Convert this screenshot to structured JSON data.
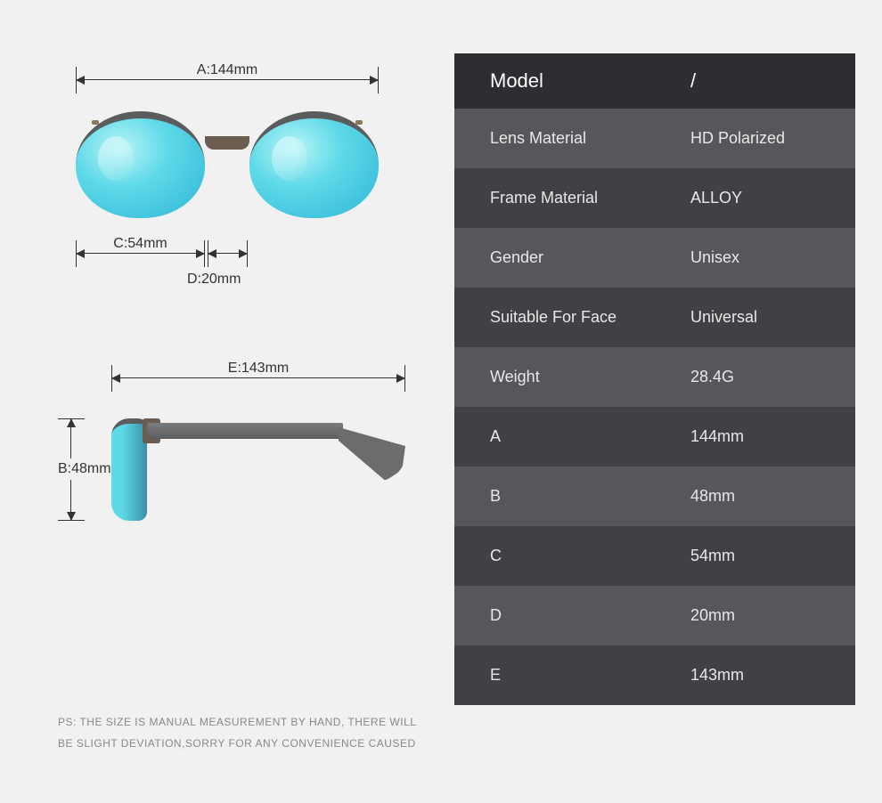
{
  "dimensions": {
    "a_label": "A:144mm",
    "b_label": "B:48mm",
    "c_label": "C:54mm",
    "d_label": "D:20mm",
    "e_label": "E:143mm"
  },
  "specs": {
    "header_key": "Model",
    "header_value": "/",
    "rows": [
      {
        "key": "Lens Material",
        "value": "HD Polarized"
      },
      {
        "key": "Frame Material",
        "value": "ALLOY"
      },
      {
        "key": "Gender",
        "value": "Unisex"
      },
      {
        "key": "Suitable For Face",
        "value": "Universal"
      },
      {
        "key": "Weight",
        "value": "28.4G"
      },
      {
        "key": "A",
        "value": "144mm"
      },
      {
        "key": "B",
        "value": "48mm"
      },
      {
        "key": "C",
        "value": "54mm"
      },
      {
        "key": "D",
        "value": "20mm"
      },
      {
        "key": "E",
        "value": "143mm"
      }
    ]
  },
  "note": "PS: THE SIZE IS MANUAL MEASUREMENT BY HAND, THERE WILL BE SLIGHT DEVIATION,SORRY FOR ANY CONVENIENCE CAUSED"
}
